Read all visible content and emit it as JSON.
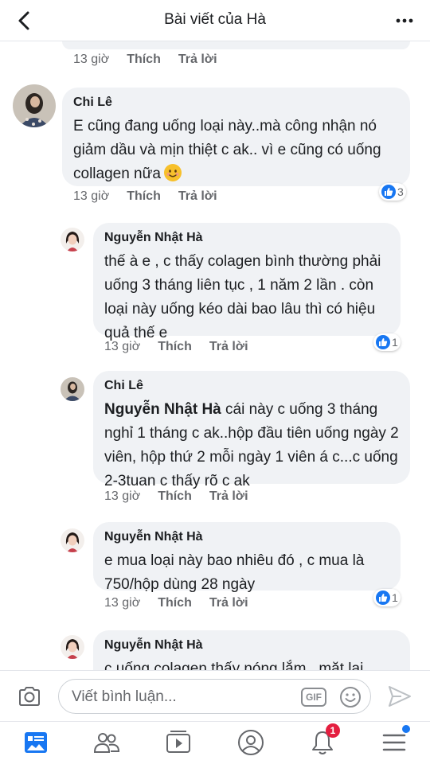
{
  "header": {
    "title": "Bài viết của Hà",
    "back_icon": "chevron-left-icon",
    "more_icon": "more-horizontal-icon"
  },
  "actions": {
    "like": "Thích",
    "reply": "Trả lời"
  },
  "top_meta": {
    "time": "13 giờ"
  },
  "comments": [
    {
      "author": "Chi Lê",
      "text_before_emoji": "E cũng đang uống loại này..mà công nhận nó giảm dầu và mịn thiệt c ak.. vì e cũng có uống collagen nữa",
      "emoji": "smiling-face-icon",
      "time": "13 giờ",
      "reactions": "3"
    },
    {
      "author": "Nguyễn Nhật Hà",
      "text": "thế à e , c thấy colagen bình thường phải uống 3 tháng liên tục , 1 năm 2 lần . còn loại này uống kéo dài bao lâu thì có hiệu quả thế e",
      "time": "13 giờ",
      "reactions": "1"
    },
    {
      "author": "Chi Lê",
      "mention": "Nguyễn Nhật Hà",
      "text": " cái này c uống 3 tháng nghỉ 1 tháng c ak..hộp đầu tiên uống ngày 2 viên, hộp thứ 2 mỗi ngày 1 viên á c...c uống 2-3tuan c thấy rõ c ak",
      "time": "13 giờ"
    },
    {
      "author": "Nguyễn Nhật Hà",
      "text": "e mua loại này bao nhiêu đó , c mua là 750/hộp dùng 28 ngày",
      "time": "13 giờ",
      "reactions": "1"
    },
    {
      "author": "Nguyễn Nhật Hà",
      "text": "c uống colagen thấy nóng lắm . mặt lại"
    }
  ],
  "composer": {
    "placeholder": "Viết bình luận...",
    "gif_label": "GIF",
    "camera_icon": "camera-icon",
    "emoji_icon": "smiley-icon",
    "send_icon": "send-icon"
  },
  "tabbar": {
    "items": [
      "news-feed-icon",
      "friends-icon",
      "watch-icon",
      "profile-icon",
      "notifications-icon",
      "menu-icon"
    ],
    "notification_count": "1",
    "accent": "#1877f2"
  }
}
